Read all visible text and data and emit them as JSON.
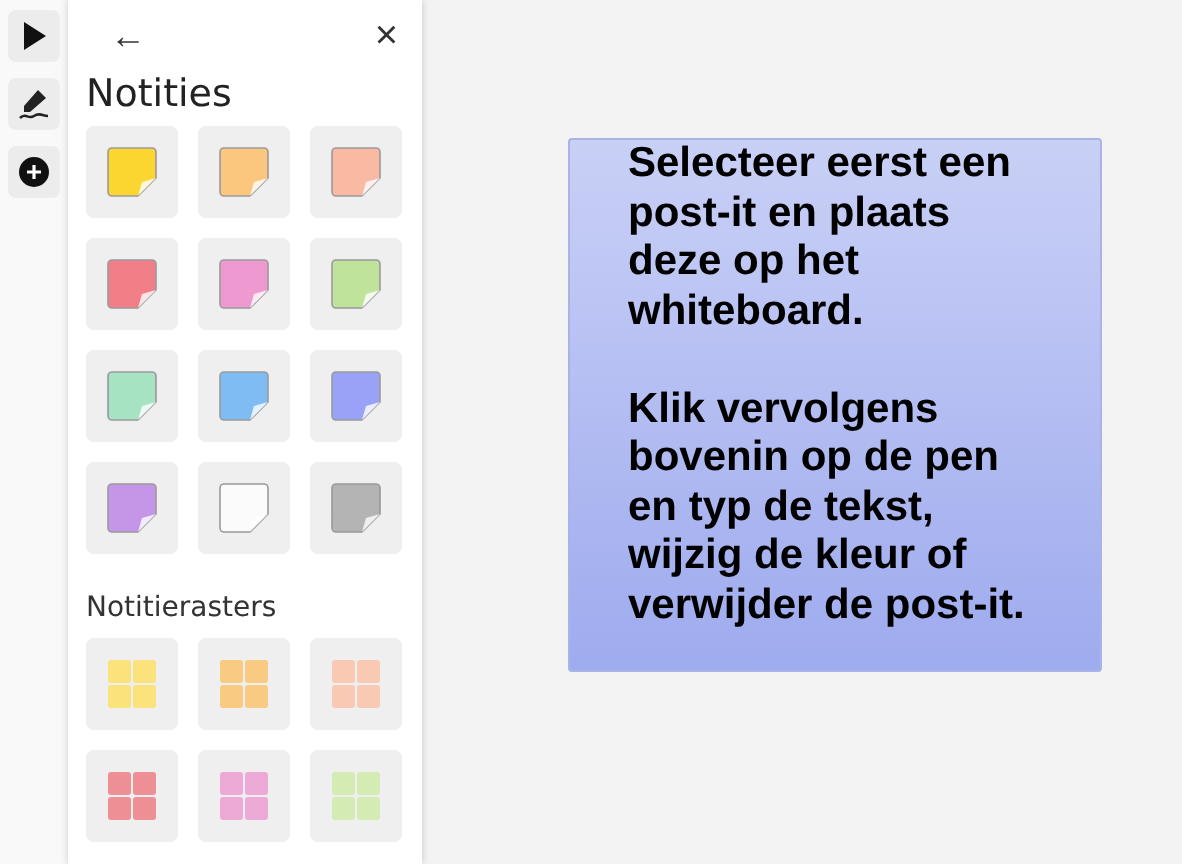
{
  "toolbar": [
    {
      "kind": "pointer"
    },
    {
      "kind": "pen"
    },
    {
      "kind": "add"
    }
  ],
  "panel": {
    "back": "←",
    "close": "×",
    "title": "Notities",
    "notes": [
      {
        "color": "#fcd630"
      },
      {
        "color": "#fbc77e"
      },
      {
        "color": "#f9b9a2"
      },
      {
        "color": "#f27f88"
      },
      {
        "color": "#ee9ad0"
      },
      {
        "color": "#bfe39a"
      },
      {
        "color": "#a6e3c3"
      },
      {
        "color": "#7fbcf3"
      },
      {
        "color": "#9aa2f8"
      },
      {
        "color": "#c596e8"
      },
      {
        "color": "#fbfbfb"
      },
      {
        "color": "#b4b4b4"
      }
    ],
    "grids_title": "Notitierasters",
    "grids": [
      {
        "color": "#fbe27a"
      },
      {
        "color": "#f9cb82"
      },
      {
        "color": "#f9c9b3"
      },
      {
        "color": "#ee8f96"
      },
      {
        "color": "#eeaad6"
      },
      {
        "color": "#d5ebb4"
      }
    ]
  },
  "sticky_note": {
    "paragraphs": [
      "Selecteer eerst een post-it en plaats deze op het whiteboard.",
      "Klik vervolgens bovenin op de pen en typ de tekst, wijzig de kleur of verwijder de post-it."
    ]
  }
}
